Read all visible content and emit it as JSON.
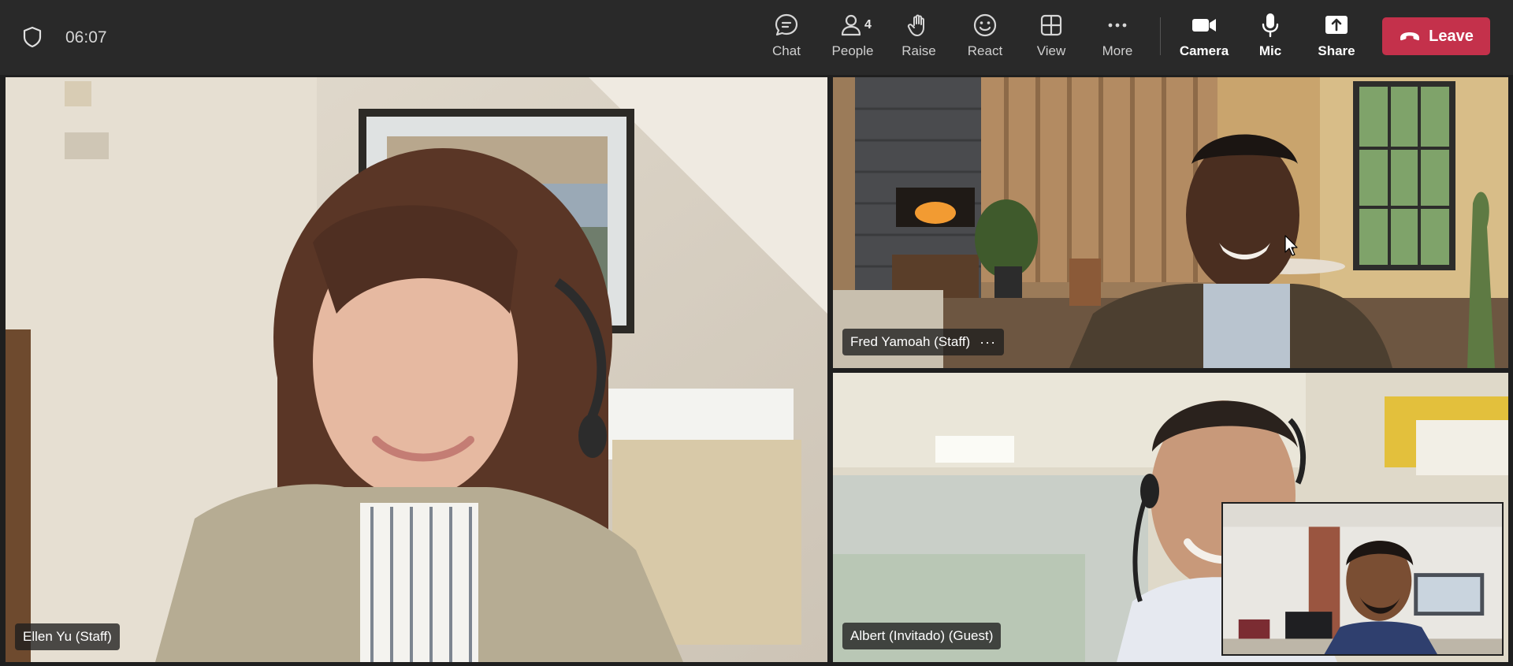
{
  "meeting": {
    "timer": "06:07"
  },
  "toolbar": {
    "chat_label": "Chat",
    "people_label": "People",
    "people_count": "4",
    "raise_label": "Raise",
    "react_label": "React",
    "view_label": "View",
    "more_label": "More",
    "camera_label": "Camera",
    "mic_label": "Mic",
    "share_label": "Share",
    "leave_label": "Leave"
  },
  "participants": [
    {
      "name": "Ellen Yu (Staff)"
    },
    {
      "name": "Fred Yamoah (Staff)",
      "more": "···"
    },
    {
      "name": "Albert (Invitado) (Guest)"
    }
  ],
  "icons": {
    "security": "shield-icon",
    "chat": "chat-bubble-icon",
    "people": "people-icon",
    "raise": "raise-hand-icon",
    "react": "smiley-icon",
    "view": "grid-view-icon",
    "more": "more-dots-icon",
    "camera": "camera-icon",
    "mic": "microphone-icon",
    "share": "share-upload-icon",
    "leave": "phone-hangup-icon"
  },
  "colors": {
    "topbar": "#292929",
    "leave_button": "#c4314b",
    "speaking_outline": "#7f85f5"
  }
}
